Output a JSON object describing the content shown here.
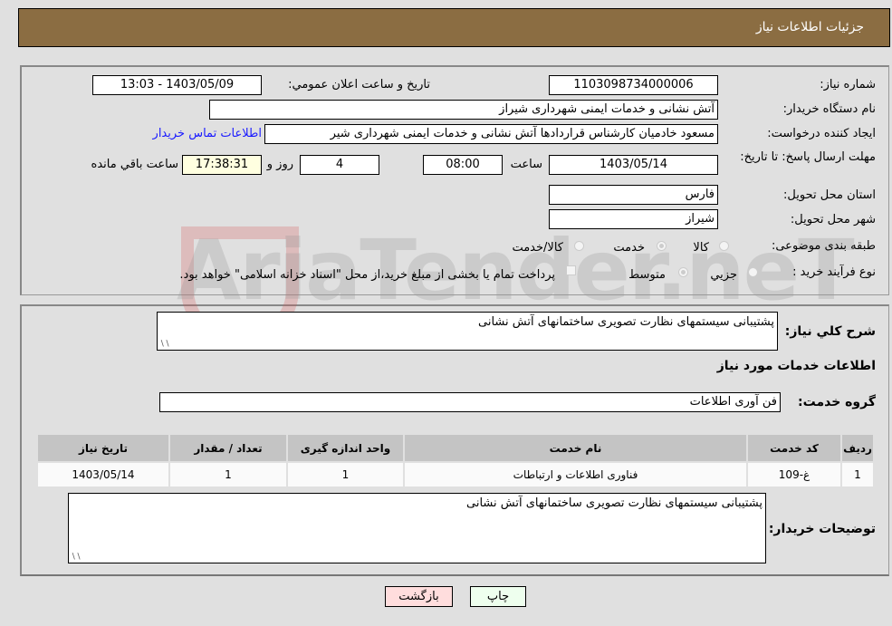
{
  "header": {
    "title": "جزئیات اطلاعات نیاز"
  },
  "form": {
    "need_number": {
      "label": "شماره نیاز:",
      "value": "1103098734000006"
    },
    "announce_datetime": {
      "label": "تاریخ و ساعت اعلان عمومي:",
      "value": "1403/05/09 - 13:03"
    },
    "buyer_org": {
      "label": "نام دستگاه خریدار:",
      "value": "آتش نشانی و خدمات ایمنی شهرداری شیراز"
    },
    "requester": {
      "label": "ایجاد کننده درخواست:",
      "value": "مسعود خادمیان کارشناس قراردادها آتش نشانی و خدمات ایمنی شهرداری شیر",
      "contact_link": "اطلاعات تماس خریدار"
    },
    "deadline": {
      "label": "مهلت ارسال پاسخ: تا تاریخ:",
      "date": "1403/05/14",
      "time_label": "ساعت",
      "time": "08:00",
      "days": "4",
      "days_label": "روز و",
      "remaining": "17:38:31",
      "remaining_label": "ساعت باقي مانده"
    },
    "province": {
      "label": "استان محل تحویل:",
      "value": "فارس"
    },
    "city": {
      "label": "شهر محل تحویل:",
      "value": "شیراز"
    },
    "category": {
      "label": "طبقه بندی موضوعی:",
      "options": [
        "کالا",
        "خدمت",
        "کالا/خدمت"
      ],
      "selected": "خدمت"
    },
    "purchase_type": {
      "label": "نوع فرآیند خرید :",
      "options": [
        "جزیي",
        "متوسط"
      ],
      "selected": "متوسط",
      "treasury_note": "پرداخت تمام یا بخشی از مبلغ خرید،از محل \"اسناد خزانه اسلامی\" خواهد بود."
    }
  },
  "details": {
    "summary_label": "شرح کلي نیاز:",
    "summary_value": "پشتیبانی سیستمهای نظارت تصویری ساختمانهای آتش نشانی",
    "services_title": "اطلاعات خدمات مورد نیاز",
    "service_group_label": "گروه خدمت:",
    "service_group_value": "فن آوری اطلاعات",
    "table": {
      "headers": [
        "ردیف",
        "کد خدمت",
        "نام خدمت",
        "واحد اندازه گیری",
        "تعداد / مقدار",
        "تاریخ نیاز"
      ],
      "rows": [
        [
          "1",
          "غ-109",
          "فناوری اطلاعات و ارتباطات",
          "1",
          "1",
          "1403/05/14"
        ]
      ]
    },
    "buyer_notes_label": "توضیحات خریدار:",
    "buyer_notes_value": "پشتیبانی سیستمهای نظارت تصویری ساختمانهای آتش نشانی"
  },
  "buttons": {
    "print": "چاپ",
    "back": "بازگشت"
  },
  "watermark": "AriaTender.neT",
  "colors": {
    "header_bg": "#8b6d42",
    "print_bg": "#eeffee",
    "back_bg": "#ffdddd",
    "link": "#1a1aff"
  }
}
